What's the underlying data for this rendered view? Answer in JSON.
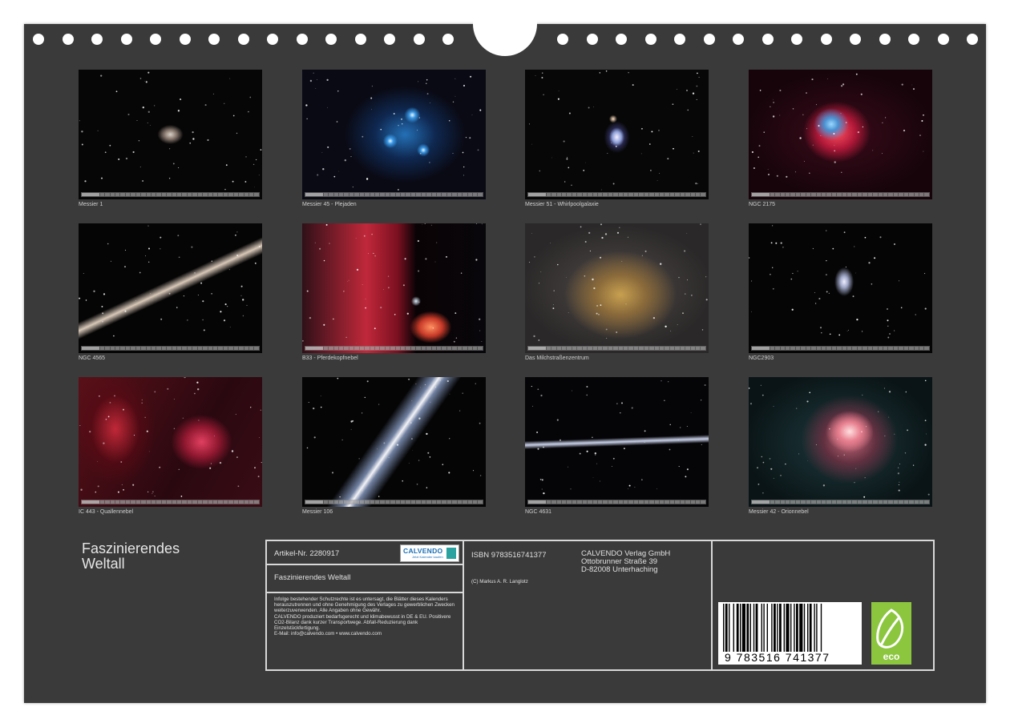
{
  "calendar": {
    "title": "Faszinierendes Weltall",
    "title_line1": "Faszinierendes",
    "title_line2": "Weltall"
  },
  "photos": [
    {
      "caption": "Messier 1",
      "scene": "crab-nebula"
    },
    {
      "caption": "Messier 45 - Plejaden",
      "scene": "pleiades"
    },
    {
      "caption": "Messier 51 - Whirlpoolgalaxie",
      "scene": "whirlpool-galaxy"
    },
    {
      "caption": "NGC 2175",
      "scene": "red-emission-nebula"
    },
    {
      "caption": "NGC 4565",
      "scene": "edge-on-galaxy"
    },
    {
      "caption": "B33 - Pferdekopfnebel",
      "scene": "horsehead-nebula"
    },
    {
      "caption": "Das Milchstraßenzentrum",
      "scene": "milky-way-center"
    },
    {
      "caption": "NGC2903",
      "scene": "spiral-galaxy"
    },
    {
      "caption": "IC 443 - Quallennebel",
      "scene": "jellyfish-nebula"
    },
    {
      "caption": "Messier 106",
      "scene": "spiral-galaxy-tilted"
    },
    {
      "caption": "NGC 4631",
      "scene": "whale-galaxy"
    },
    {
      "caption": "Messier 42 - Orionnebel",
      "scene": "orion-nebula"
    }
  ],
  "info": {
    "article": "Artikel-Nr. 2280917",
    "logo_text": "CALVENDO",
    "logo_sub": "Jetzt Kalender kaufen",
    "product_title": "Faszinierendes Weltall",
    "legal": "Infolge bestehender Schutzrechte ist es untersagt, die Blätter dieses Kalenders herauszutrennen und ohne Genehmigung des Verlages zu gewerblichen Zwecken weiterzuverwenden. Alle Angaben ohne Gewähr.",
    "legal2": "CALVENDO produziert bedarfsgerecht und klimabewusst in DE & EU. Positivere CO2-Bilanz dank kurzer Transportwege. Abfall-Reduzierung dank Einzelstückfertigung.",
    "email": "E-Mail: info@calvendo.com • www.calvendo.com",
    "isbn": "ISBN 9783516741377",
    "copyright": "(C) Markus A. R. Langlotz",
    "publisher_name": "CALVENDO Verlag GmbH",
    "publisher_street": "Ottobrunner Straße 39",
    "publisher_city": "D-82008 Unterhaching",
    "barcode_number": "9 783516 741377",
    "eco_label": "eco"
  },
  "colors": {
    "sheet": "#3a3a3a",
    "eco_green": "#8cc63f",
    "calvendo_blue": "#1a6fb5"
  }
}
